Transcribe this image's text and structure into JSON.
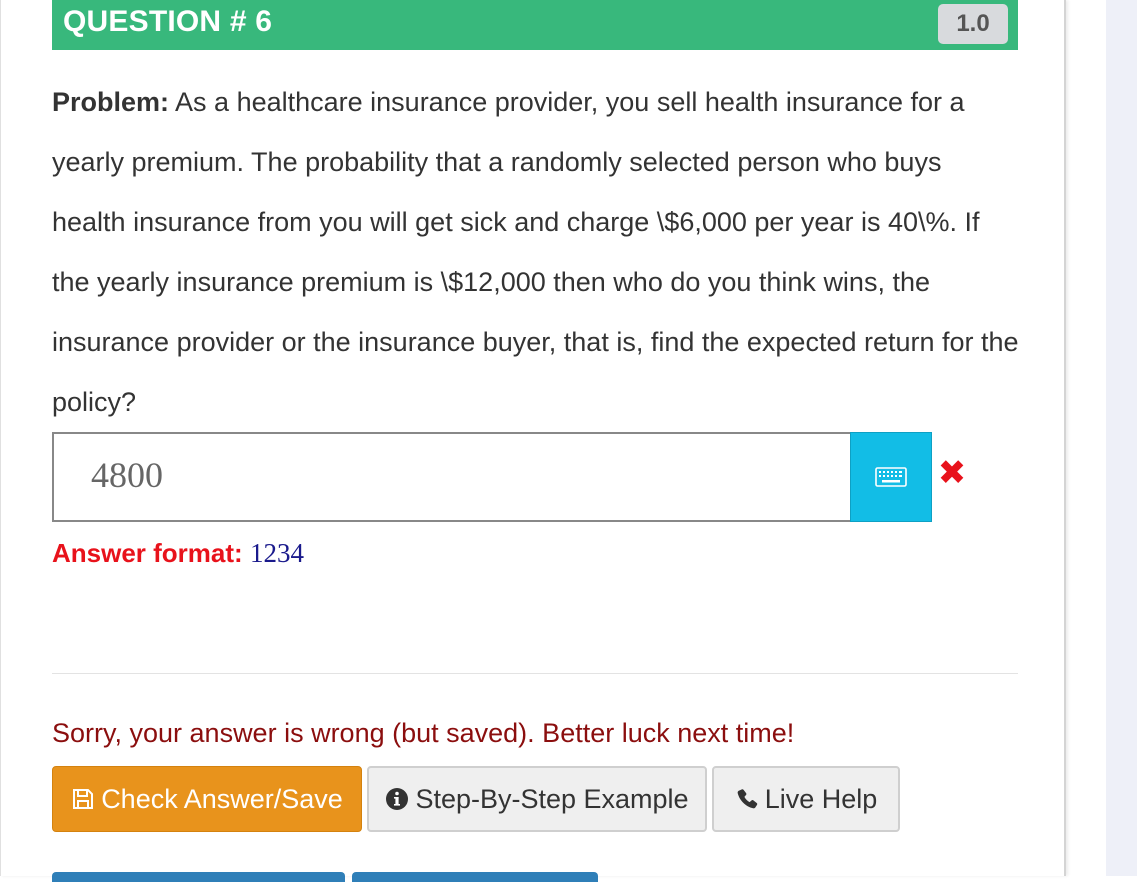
{
  "header": {
    "title": "QUESTION # 6",
    "points": "1.0",
    "color": "#38b87c"
  },
  "problem": {
    "label": "Problem:",
    "text": "As a healthcare insurance provider, you sell health insurance for a yearly premium. The probability that a randomly selected person who buys health insurance from you will get sick and charge \\$6,000 per year is 40\\%. If the yearly insurance premium is \\$12,000 then who do you think wins, the insurance provider or the insurance buyer, that is, find the expected return for the policy?"
  },
  "answer": {
    "value": "4800",
    "keyboard_icon": "keyboard-icon",
    "status_icon": "wrong-x-icon"
  },
  "format": {
    "label": "Answer format:",
    "example": "1234"
  },
  "feedback": "Sorry, your answer is wrong (but saved). Better luck next time!",
  "buttons": {
    "check": "Check Answer/Save",
    "step": "Step-By-Step Example",
    "help": "Live Help"
  },
  "colors": {
    "check_button": "#e8931c",
    "keyboard_button": "#12bde6",
    "error": "#e8121b",
    "feedback": "#8b0e0e"
  }
}
